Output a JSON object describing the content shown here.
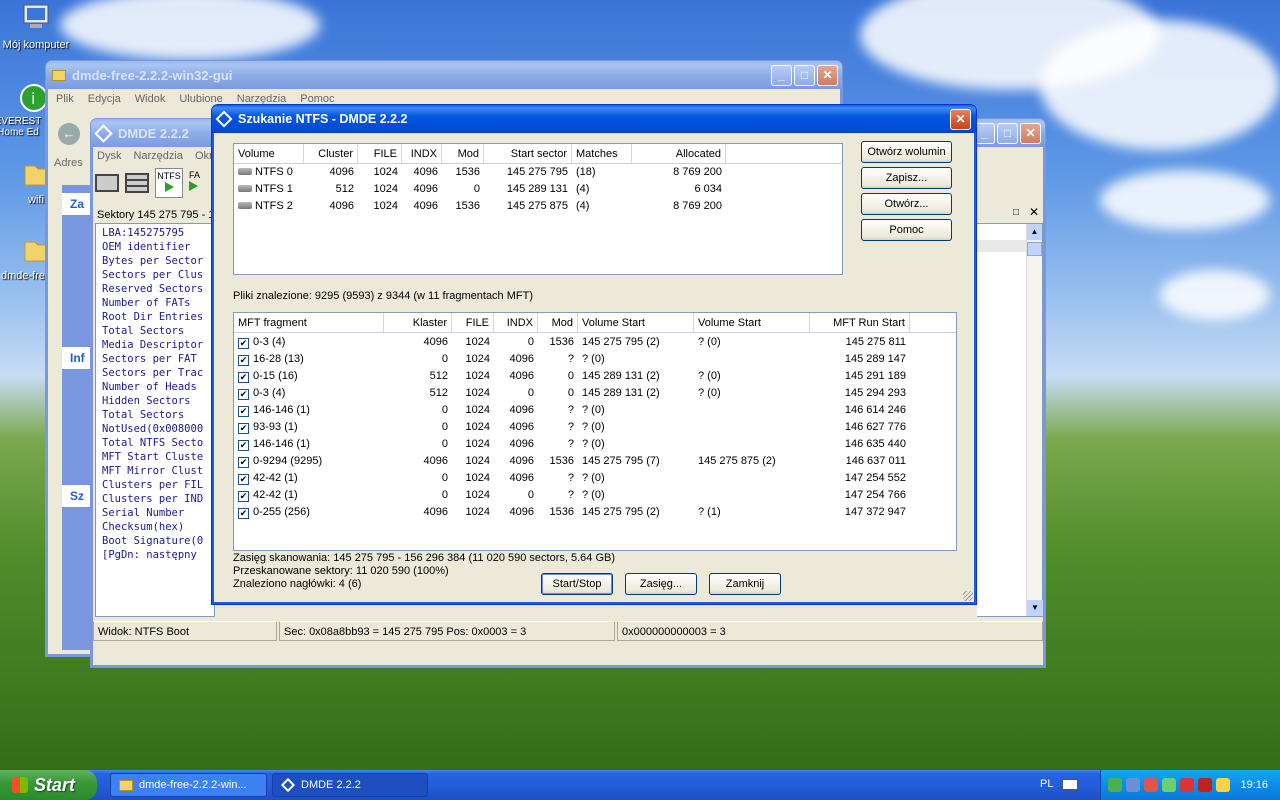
{
  "desktop": {
    "icons": [
      {
        "label": "Mój komputer",
        "icon": "computer-icon"
      },
      {
        "label": "EVEREST Home Ed",
        "icon": "everest-icon"
      },
      {
        "label": "wifi",
        "icon": "folder-icon"
      },
      {
        "label": "dmde-fre",
        "icon": "folder-icon"
      }
    ]
  },
  "explorer": {
    "title": "dmde-free-2.2.2-win32-gui",
    "menu": [
      "Plik",
      "Edycja",
      "Widok",
      "Ulubione",
      "Narzędzia",
      "Pomoc"
    ],
    "address_label": "Adres",
    "side": [
      "Za",
      "Inf",
      "Sz"
    ]
  },
  "dmde": {
    "title": "DMDE 2.2.2",
    "menu": [
      "Dysk",
      "Narzędzia",
      "Okn"
    ],
    "toolbar_tab": "NTFS",
    "toolbar_tab2": "FA",
    "sectors_label": "Sektory 145 275 795 - 1",
    "boot_lines": [
      "LBA:145275795",
      "OEM identifier",
      "Bytes per Sector",
      "Sectors per Clus",
      "Reserved Sectors",
      "Number of FATs",
      "Root Dir Entries",
      "Total Sectors",
      "Media Descriptor",
      "Sectors per FAT",
      "Sectors per Trac",
      "Number of Heads",
      "Hidden Sectors",
      "Total Sectors",
      "NotUsed(0x008000",
      "Total NTFS Secto",
      "MFT Start Cluste",
      "MFT Mirror Clust",
      "Clusters per FIL",
      "Clusters per IND",
      "Serial Number",
      "Checksum(hex)",
      "Boot Signature(0",
      "[PgDn: następny"
    ],
    "status": [
      "Widok: NTFS Boot",
      "Sec: 0x08a8bb93 = 145 275 795  Pos: 0x0003 = 3",
      "0x000000000003 = 3"
    ]
  },
  "dialog": {
    "title": "Szukanie NTFS - DMDE 2.2.2",
    "vol_headers": [
      "Volume",
      "Cluster",
      "FILE",
      "INDX",
      "Mod",
      "Start sector",
      "Matches",
      "Allocated"
    ],
    "volumes": [
      [
        "NTFS 0",
        "4096",
        "1024",
        "4096",
        "1536",
        "145 275 795",
        "(18)",
        "8 769 200"
      ],
      [
        "NTFS 1",
        "512",
        "1024",
        "4096",
        "0",
        "145 289 131",
        "(4)",
        "6 034"
      ],
      [
        "NTFS 2",
        "4096",
        "1024",
        "4096",
        "1536",
        "145 275 875",
        "(4)",
        "8 769 200"
      ]
    ],
    "buttons": {
      "open_volume": "Otwórz wolumin",
      "save": "Zapisz...",
      "open": "Otwórz...",
      "help": "Pomoc",
      "startstop": "Start/Stop",
      "range": "Zasięg...",
      "close": "Zamknij"
    },
    "found_label": "Pliki znalezione: 9295 (9593) z 9344 (w 11 fragmentach MFT)",
    "mft_headers": [
      "MFT fragment",
      "Klaster",
      "FILE",
      "INDX",
      "Mod",
      "Volume Start",
      "Volume Start",
      "MFT Run Start"
    ],
    "mft": [
      [
        "0-3 (4)",
        "4096",
        "1024",
        "0",
        "1536",
        "145 275 795 (2)",
        "? (0)",
        "145 275 811"
      ],
      [
        "16-28 (13)",
        "0",
        "1024",
        "4096",
        "?",
        "? (0)",
        "",
        "145 289 147"
      ],
      [
        "0-15 (16)",
        "512",
        "1024",
        "4096",
        "0",
        "145 289 131 (2)",
        "? (0)",
        "145 291 189"
      ],
      [
        "0-3 (4)",
        "512",
        "1024",
        "0",
        "0",
        "145 289 131 (2)",
        "? (0)",
        "145 294 293"
      ],
      [
        "146-146 (1)",
        "0",
        "1024",
        "4096",
        "?",
        "? (0)",
        "",
        "146 614 246"
      ],
      [
        "93-93 (1)",
        "0",
        "1024",
        "4096",
        "?",
        "? (0)",
        "",
        "146 627 776"
      ],
      [
        "146-146 (1)",
        "0",
        "1024",
        "4096",
        "?",
        "? (0)",
        "",
        "146 635 440"
      ],
      [
        "0-9294 (9295)",
        "4096",
        "1024",
        "4096",
        "1536",
        "145 275 795 (7)",
        "145 275 875 (2)",
        "146 637 011"
      ],
      [
        "42-42 (1)",
        "0",
        "1024",
        "4096",
        "?",
        "? (0)",
        "",
        "147 254 552"
      ],
      [
        "42-42 (1)",
        "0",
        "1024",
        "0",
        "?",
        "? (0)",
        "",
        "147 254 766"
      ],
      [
        "0-255 (256)",
        "4096",
        "1024",
        "4096",
        "1536",
        "145 275 795 (2)",
        "? (1)",
        "147 372 947"
      ]
    ],
    "scan_range": "Zasięg skanowania: 145 275 795 - 156 296 384 (11 020 590 sectors, 5.64 GB)",
    "scanned": "Przeskanowane sektory: 11 020 590 (100%)",
    "headers_found": "Znaleziono nagłówki: 4 (6)"
  },
  "taskbar": {
    "start": "Start",
    "tasks": [
      "dmde-free-2.2.2-win...",
      "DMDE 2.2.2"
    ],
    "lang": "PL",
    "clock": "19:16"
  }
}
